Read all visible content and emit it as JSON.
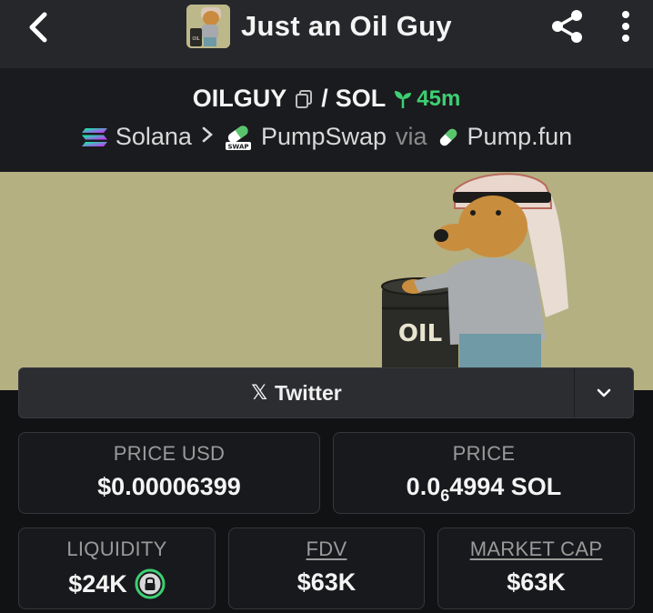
{
  "header": {
    "title": "Just an Oil Guy",
    "avatar_barrel_label": "OIL"
  },
  "pair": {
    "base": "OILGUY",
    "separator": "/",
    "quote": "SOL",
    "age": "45m",
    "age_color": "#3ecf72"
  },
  "chain": {
    "network": "Solana",
    "dex": "PumpSwap",
    "dex_badge": "SWAP",
    "via": "via",
    "launchpad": "Pump.fun"
  },
  "banner": {
    "barrel_label": "OIL"
  },
  "socials": {
    "twitter_label": "Twitter",
    "twitter_glyph": "𝕏"
  },
  "stats": {
    "price_usd_label": "PRICE USD",
    "price_usd_value": "$0.00006399",
    "price_label": "PRICE",
    "price_value_prefix": "0.0",
    "price_value_zeros": "6",
    "price_value_suffix": "4994 SOL",
    "liquidity_label": "LIQUIDITY",
    "liquidity_value": "$24K",
    "fdv_label": "FDV",
    "fdv_value": "$63K",
    "market_cap_label": "MARKET CAP",
    "market_cap_value": "$63K"
  },
  "colors": {
    "background": "#111214",
    "header": "#26272b",
    "banner": "#b3ae80",
    "accent_green": "#3ecf72"
  }
}
